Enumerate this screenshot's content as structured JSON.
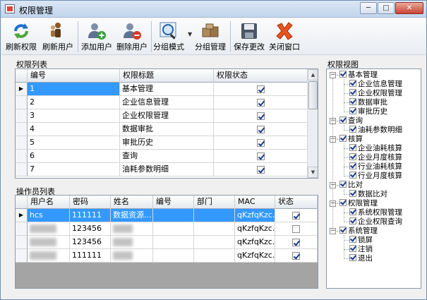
{
  "window": {
    "title": "权限管理"
  },
  "toolbar": {
    "refresh_perms": "刷新权限",
    "refresh_users": "刷新用户",
    "add_user": "添加用户",
    "delete_user": "删除用户",
    "group_mode": "分组模式",
    "group_manage": "分组管理",
    "save_changes": "保存更改",
    "close_window": "关闭窗口"
  },
  "perm_list": {
    "title": "权限列表",
    "columns": [
      "编号",
      "权限标题",
      "权限状态"
    ],
    "rows": [
      {
        "id": "1",
        "title": "基本管理",
        "checked": true
      },
      {
        "id": "2",
        "title": "企业信息管理",
        "checked": true
      },
      {
        "id": "3",
        "title": "企业权限管理",
        "checked": true
      },
      {
        "id": "4",
        "title": "数据审批",
        "checked": true
      },
      {
        "id": "5",
        "title": "审批历史",
        "checked": true
      },
      {
        "id": "6",
        "title": "查询",
        "checked": true
      },
      {
        "id": "7",
        "title": "油耗参数明细",
        "checked": true
      }
    ]
  },
  "user_list": {
    "title": "操作员列表",
    "columns": [
      "用户名",
      "密码",
      "姓名",
      "编号",
      "部门",
      "MAC",
      "状态"
    ],
    "rows": [
      {
        "username": "hcs",
        "password": "111111",
        "name": "数据资源...",
        "mac": "qKzfqKzc...",
        "checked": true
      },
      {
        "username": "",
        "password": "123456",
        "name": "",
        "mac": "qKzfqKzc...",
        "checked": false
      },
      {
        "username": "",
        "password": "123456",
        "name": "",
        "mac": "qKzfqKzc...",
        "checked": true
      },
      {
        "username": "",
        "password": "111111",
        "name": "",
        "mac": "qKzfqKzc...",
        "checked": true
      }
    ]
  },
  "perm_tree": {
    "title": "权限视图",
    "nodes": [
      {
        "label": "基本管理",
        "children": [
          "企业信息管理",
          "企业权限管理",
          "数据审批",
          "审批历史"
        ]
      },
      {
        "label": "查询",
        "children": [
          "油耗参数明细"
        ]
      },
      {
        "label": "核算",
        "children": [
          "企业油耗核算",
          "企业月度核算",
          "行业油耗核算",
          "行业月度核算"
        ]
      },
      {
        "label": "比对",
        "children": [
          "数据比对"
        ]
      },
      {
        "label": "权限管理",
        "children": [
          "系统权限管理",
          "企业权限查询"
        ]
      },
      {
        "label": "系统管理",
        "children": [
          "锁屏",
          "注销",
          "退出"
        ]
      }
    ]
  },
  "colors": {
    "selection": "#3399ff",
    "gray_area": "#a4a4a4"
  }
}
